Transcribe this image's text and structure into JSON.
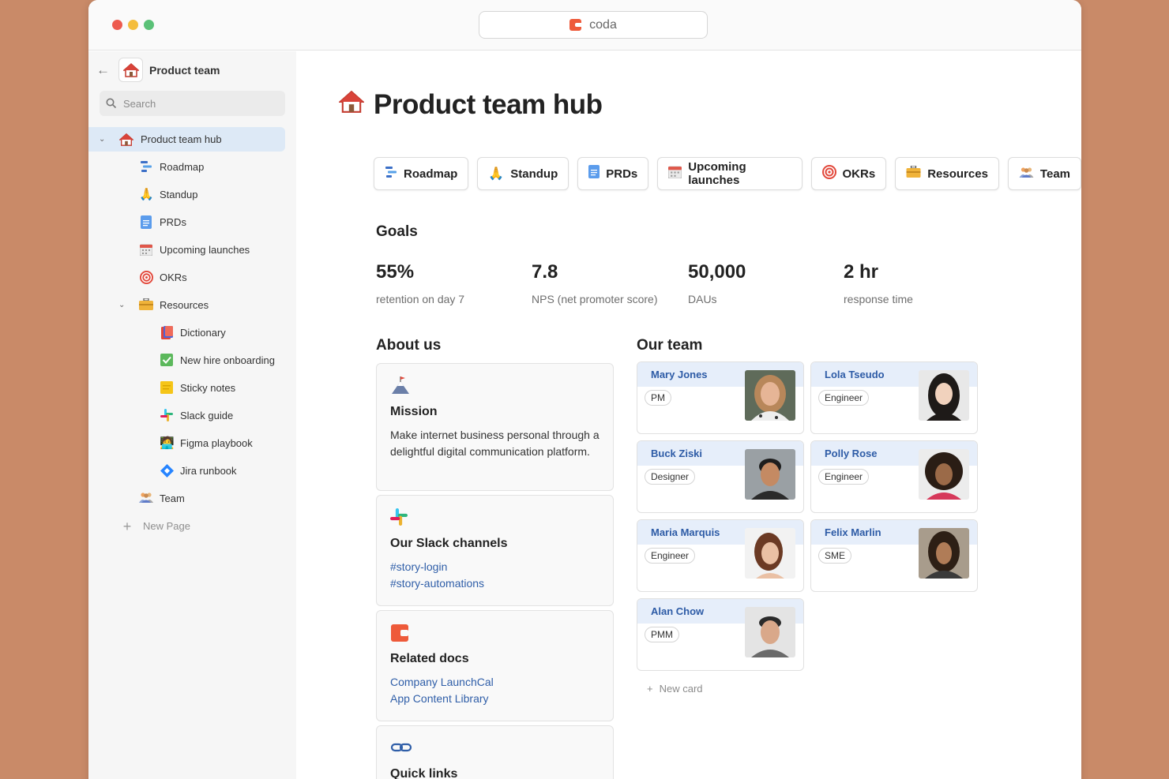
{
  "browser": {
    "url_text": "coda"
  },
  "sidebar": {
    "doc_title": "Product team",
    "search_placeholder": "Search",
    "items": [
      {
        "label": "Product team hub",
        "icon": "house-icon"
      },
      {
        "label": "Roadmap",
        "icon": "roadmap-icon"
      },
      {
        "label": "Standup",
        "icon": "hands-icon"
      },
      {
        "label": "PRDs",
        "icon": "document-icon"
      },
      {
        "label": "Upcoming launches",
        "icon": "calendar-icon"
      },
      {
        "label": "OKRs",
        "icon": "target-icon"
      },
      {
        "label": "Resources",
        "icon": "toolbox-icon"
      },
      {
        "label": "Dictionary",
        "icon": "books-icon"
      },
      {
        "label": "New hire onboarding",
        "icon": "checkbox-icon"
      },
      {
        "label": "Sticky notes",
        "icon": "sticky-note-icon"
      },
      {
        "label": "Slack guide",
        "icon": "slack-icon"
      },
      {
        "label": "Figma playbook",
        "icon": "person-laptop-icon"
      },
      {
        "label": "Jira runbook",
        "icon": "jira-icon"
      },
      {
        "label": "Team",
        "icon": "people-icon"
      }
    ],
    "new_page": "New Page"
  },
  "page": {
    "title": "Product team hub",
    "buttons": [
      {
        "label": "Roadmap"
      },
      {
        "label": "Standup"
      },
      {
        "label": "PRDs"
      },
      {
        "label": "Upcoming launches"
      },
      {
        "label": "OKRs"
      },
      {
        "label": "Resources"
      },
      {
        "label": "Team"
      }
    ],
    "goals_heading": "Goals",
    "goals": [
      {
        "value": "55%",
        "label": "retention on day 7"
      },
      {
        "value": "7.8",
        "label": "NPS (net promoter score)"
      },
      {
        "value": "50,000",
        "label": "DAUs"
      },
      {
        "value": "2 hr",
        "label": "response time"
      }
    ],
    "about_heading": "About us",
    "about": {
      "mission_title": "Mission",
      "mission_text": "Make internet business personal through a delightful digital communication platform.",
      "slack_title": "Our Slack channels",
      "slack_links": [
        "#story-login",
        "#story-automations"
      ],
      "related_title": "Related docs",
      "related_links": [
        "Company LaunchCal",
        "App Content Library"
      ],
      "quick_title": "Quick links"
    },
    "team_heading": "Our team",
    "team": [
      {
        "name": "Mary Jones",
        "role": "PM"
      },
      {
        "name": "Lola Tseudo",
        "role": "Engineer"
      },
      {
        "name": "Buck Ziski",
        "role": "Designer"
      },
      {
        "name": "Polly Rose",
        "role": "Engineer"
      },
      {
        "name": "Maria Marquis",
        "role": "Engineer"
      },
      {
        "name": "Felix Marlin",
        "role": "SME"
      },
      {
        "name": "Alan Chow",
        "role": "PMM"
      }
    ],
    "new_card": "New card"
  },
  "colors": {
    "background": "#c98a68",
    "accent": "#ee5a3a",
    "link": "#2f5ea8",
    "active_nav": "#dde9f6",
    "team_band": "#e6eefa"
  }
}
